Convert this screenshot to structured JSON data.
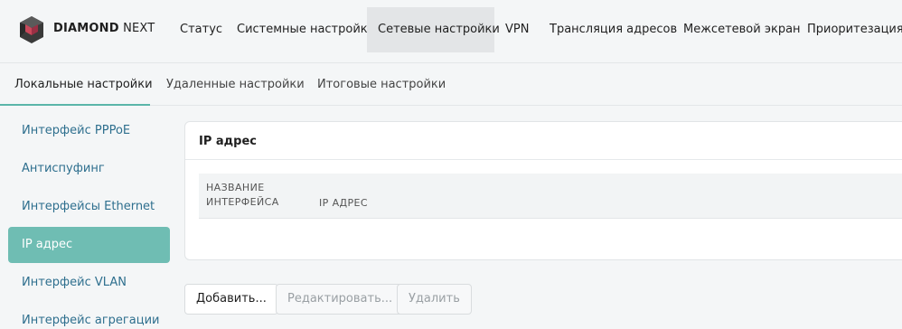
{
  "brand": {
    "name_bold": "DIAMOND",
    "name_light": "NEXT",
    "logo_icon": "diamond-logo-icon"
  },
  "top_nav": [
    {
      "label": "Статус",
      "active": false
    },
    {
      "label": "Системные настройки",
      "active": false
    },
    {
      "label": "Сетевые настройки",
      "active": true
    },
    {
      "label": "VPN",
      "active": false
    },
    {
      "label": "Трансляция адресов",
      "active": false
    },
    {
      "label": "Межсетевой экран",
      "active": false
    },
    {
      "label": "Приоритезация",
      "active": false
    }
  ],
  "sub_tabs": [
    {
      "label": "Локальные настройки",
      "active": true
    },
    {
      "label": "Удаленные настройки",
      "active": false
    },
    {
      "label": "Итоговые настройки",
      "active": false
    }
  ],
  "sidebar": [
    {
      "label": "Интерфейс PPPoE",
      "active": false
    },
    {
      "label": "Антиспуфинг",
      "active": false
    },
    {
      "label": "Интерфейсы Ethernet",
      "active": false
    },
    {
      "label": "IP адрес",
      "active": true
    },
    {
      "label": "Интерфейс VLAN",
      "active": false
    },
    {
      "label": "Интерфейс агрегации",
      "active": false
    }
  ],
  "card": {
    "title": "IP адрес",
    "columns": [
      "НАЗВАНИЕ\nИНТЕРФЕЙСА",
      "IP АДРЕС"
    ],
    "rows": []
  },
  "actions": [
    {
      "label": "Добавить...",
      "enabled": true
    },
    {
      "label": "Редактировать...",
      "enabled": false
    },
    {
      "label": "Удалить",
      "enabled": false
    }
  ],
  "colors": {
    "accent": "#6fbdb3",
    "link": "#2e6f8e",
    "active_tab_underline": "#5ab5a9"
  }
}
